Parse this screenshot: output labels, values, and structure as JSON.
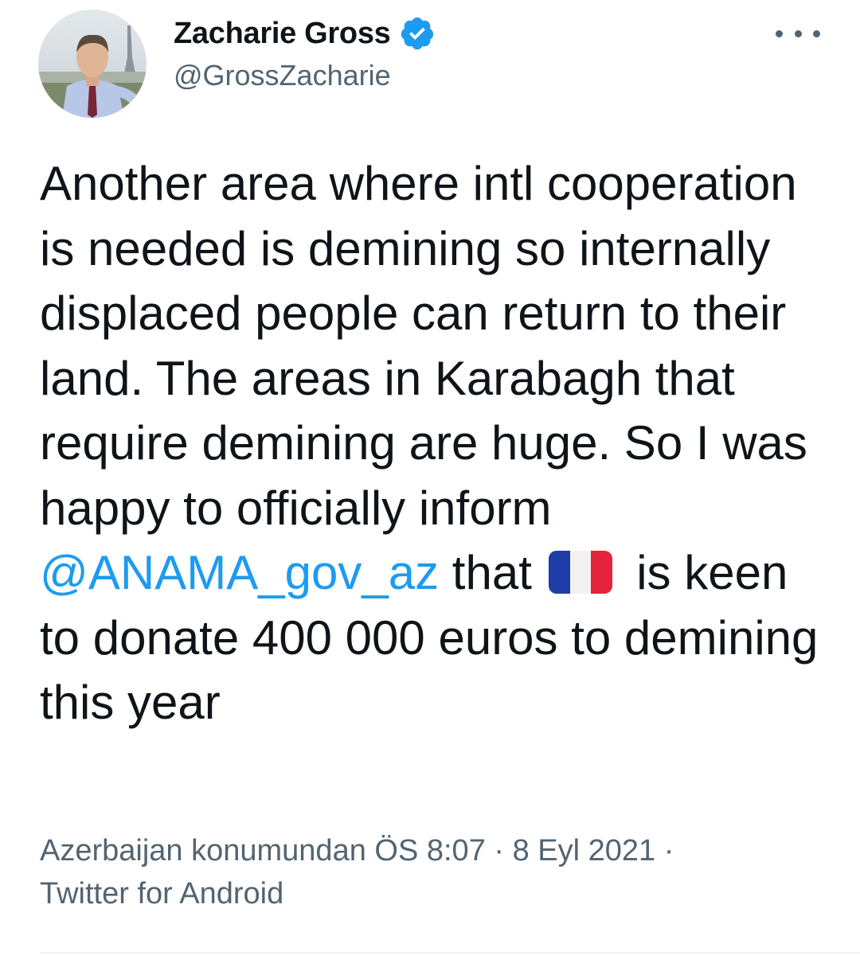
{
  "author": {
    "display_name": "Zacharie Gross",
    "handle": "@GrossZacharie",
    "verified": true,
    "avatar_icon": "profile-photo"
  },
  "tweet": {
    "text_before_mention": "Another area where intl cooperation is needed is demining so internally displaced people can return to their land. The areas in Karabagh that require demining are huge. So I was happy to officially inform ",
    "mention": "@ANAMA_gov_az",
    "text_after_mention": " that ",
    "flag_emoji": "french-flag",
    "text_after_flag": " is keen to donate 400 000 euros to demining this year"
  },
  "meta": {
    "location": "Azerbaijan konumundan",
    "time": "ÖS 8:07",
    "separator": "·",
    "date": "8 Eyl 2021",
    "source": "Twitter for Android"
  },
  "colors": {
    "accent": "#1d9bf0",
    "text": "#0f1419",
    "secondary": "#536471"
  }
}
